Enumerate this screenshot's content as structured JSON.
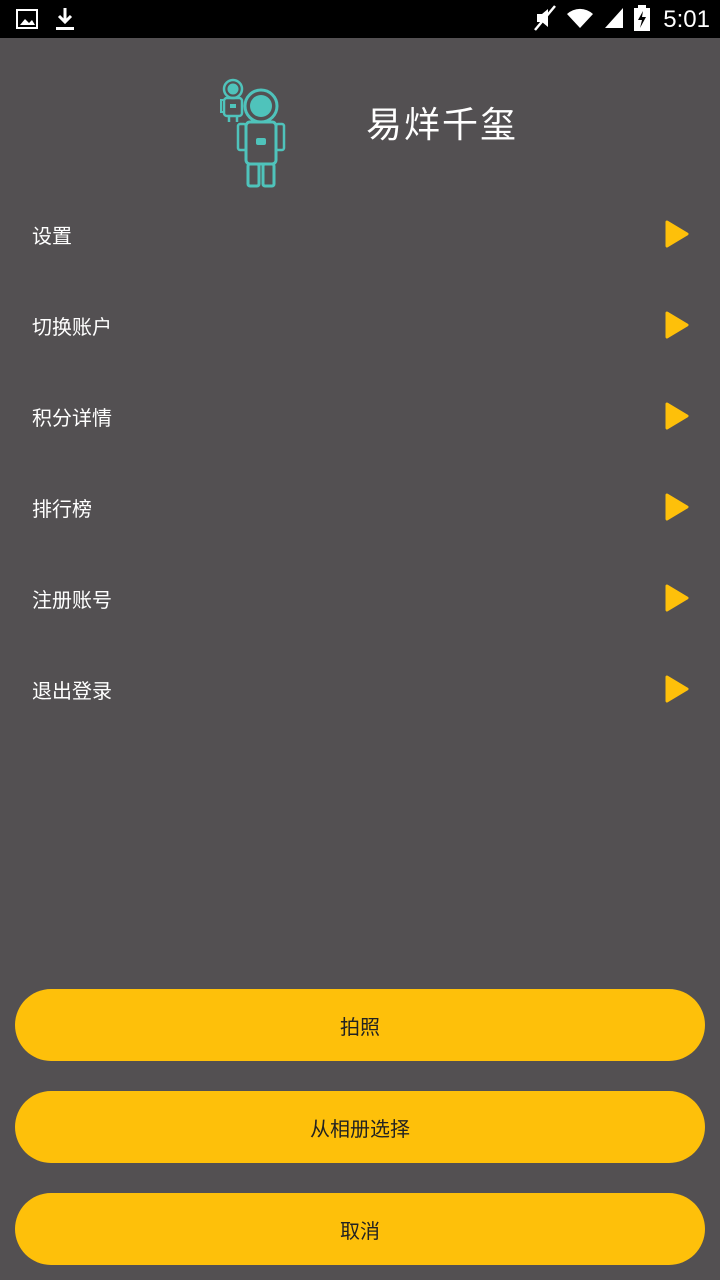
{
  "status_bar": {
    "time": "5:01",
    "icons": [
      "image-icon",
      "download-icon",
      "mute-icon",
      "wifi-icon",
      "signal-icon",
      "battery-icon"
    ]
  },
  "profile": {
    "name": "易烊千玺",
    "avatar_icon": "astronaut-icon"
  },
  "menu": {
    "items": [
      {
        "label": "设置"
      },
      {
        "label": "切换账户"
      },
      {
        "label": "积分详情"
      },
      {
        "label": "排行榜"
      },
      {
        "label": "注册账号"
      },
      {
        "label": "退出登录"
      }
    ],
    "arrow_color": "#fec00a"
  },
  "sheet": {
    "take_photo": "拍照",
    "choose_album": "从相册选择",
    "cancel": "取消"
  },
  "colors": {
    "background": "#535052",
    "accent": "#fec00a",
    "avatar_teal": "#4fc3bb"
  }
}
